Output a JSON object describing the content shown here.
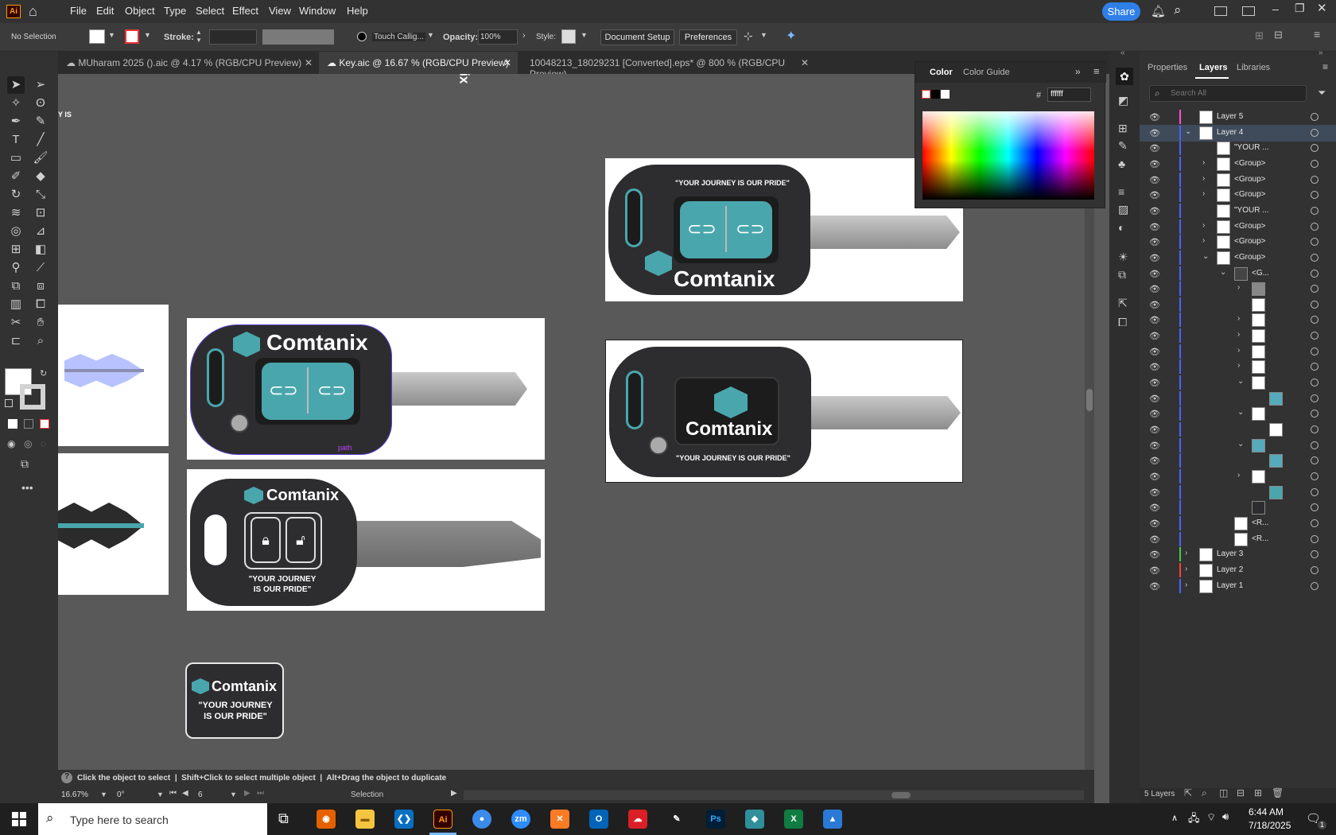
{
  "app": {
    "logo": "Ai",
    "home_icon": "home-icon"
  },
  "menu": [
    "File",
    "Edit",
    "Object",
    "Type",
    "Select",
    "Effect",
    "View",
    "Window",
    "Help"
  ],
  "share_label": "Share",
  "control": {
    "selection": "No Selection",
    "stroke_label": "Stroke:",
    "brush": "Touch Callig...",
    "opacity_label": "Opacity:",
    "opacity_value": "100%",
    "style_label": "Style:",
    "doc_setup": "Document Setup",
    "preferences": "Preferences"
  },
  "tabs": [
    {
      "label": "MUharam 2025 ().aic @ 4.17 % (RGB/CPU Preview)"
    },
    {
      "label": "Key.aic @ 16.67 % (RGB/CPU Preview)"
    },
    {
      "label": "10048213_18029231 [Converted].eps* @ 800 % (RGB/CPU Preview)"
    }
  ],
  "canvas": {
    "cut_top": "nix",
    "cut_left": "Y IS",
    "path_label": "path"
  },
  "art": {
    "brand": "Comtanix",
    "slogan": "\"YOUR JOURNEY IS OUR PRIDE\"",
    "slogan_l1": "\"YOUR JOURNEY",
    "slogan_l2": "IS OUR PRIDE\""
  },
  "color_panel": {
    "tab_color": "Color",
    "tab_guide": "Color Guide",
    "hex_label": "#",
    "hex_value": "ffffff",
    "accent": "#2f7fe8"
  },
  "layers_panel": {
    "tabs": [
      "Properties",
      "Layers",
      "Libraries"
    ],
    "search_placeholder": "Search All",
    "footer": "5 Layers",
    "rows": [
      {
        "name": "Layer 5"
      },
      {
        "name": "Layer 4"
      },
      {
        "name": "\"YOUR ..."
      },
      {
        "name": "<Group>"
      },
      {
        "name": "<Group>"
      },
      {
        "name": "<Group>"
      },
      {
        "name": "\"YOUR ..."
      },
      {
        "name": "<Group>"
      },
      {
        "name": "<Group>"
      },
      {
        "name": "<Group>"
      },
      {
        "name": "<G..."
      },
      {
        "name": ""
      },
      {
        "name": ""
      },
      {
        "name": ""
      },
      {
        "name": ""
      },
      {
        "name": ""
      },
      {
        "name": ""
      },
      {
        "name": ""
      },
      {
        "name": ""
      },
      {
        "name": ""
      },
      {
        "name": ""
      },
      {
        "name": ""
      },
      {
        "name": ""
      },
      {
        "name": ""
      },
      {
        "name": ""
      },
      {
        "name": ""
      },
      {
        "name": "<R..."
      },
      {
        "name": "<R..."
      },
      {
        "name": "Layer 3"
      },
      {
        "name": "Layer 2"
      },
      {
        "name": "Layer 1"
      }
    ]
  },
  "status": {
    "hint": "Click the object to select  |  Shift+Click to select multiple object  |  Alt+Drag the object to duplicate",
    "zoom": "16.67%",
    "angle": "0°",
    "artboard": "6",
    "tool": "Selection"
  },
  "taskbar": {
    "search_placeholder": "Type here to search",
    "time": "6:44 AM",
    "date": "7/18/2025",
    "notif": "1"
  }
}
